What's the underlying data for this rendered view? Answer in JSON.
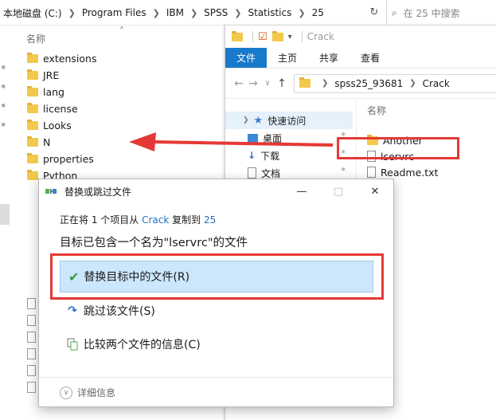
{
  "back_window": {
    "breadcrumb": [
      "本地磁盘 (C:)",
      "Program Files",
      "IBM",
      "SPSS",
      "Statistics",
      "25"
    ],
    "search_placeholder": "在 25 中搜索",
    "column_header": "名称",
    "files": [
      {
        "name": "extensions",
        "type": "folder"
      },
      {
        "name": "JRE",
        "type": "folder"
      },
      {
        "name": "lang",
        "type": "folder"
      },
      {
        "name": "license",
        "type": "folder"
      },
      {
        "name": "Looks",
        "type": "folder"
      },
      {
        "name": "N",
        "type": "folder"
      },
      {
        "name": "properties",
        "type": "folder"
      },
      {
        "name": "Python",
        "type": "folder"
      }
    ]
  },
  "front_window": {
    "title": "Crack",
    "ribbon_tabs": [
      "文件",
      "主页",
      "共享",
      "查看"
    ],
    "breadcrumb": [
      "spss25_93681",
      "Crack"
    ],
    "nav_pane": {
      "quick_access": "快速访问",
      "items": [
        "桌面",
        "下载",
        "文档"
      ]
    },
    "column_header": "名称",
    "files": [
      {
        "name": "Another",
        "type": "folder"
      },
      {
        "name": "lservrc",
        "type": "file"
      },
      {
        "name": "Readme.txt",
        "type": "file"
      }
    ]
  },
  "dialog": {
    "title": "替换或跳过文件",
    "status_prefix": "正在将 1 个项目从",
    "status_source": "Crack",
    "status_mid": "复制到",
    "status_dest": "25",
    "heading": "目标已包含一个名为\"lservrc\"的文件",
    "options": {
      "replace": "替换目标中的文件(R)",
      "skip": "跳过该文件(S)",
      "compare": "比较两个文件的信息(C)"
    },
    "footer": "详细信息"
  },
  "colors": {
    "highlight": "#e53935",
    "selection": "#cce6fb",
    "file_tab": "#1979ca",
    "link": "#1f6fc0"
  }
}
